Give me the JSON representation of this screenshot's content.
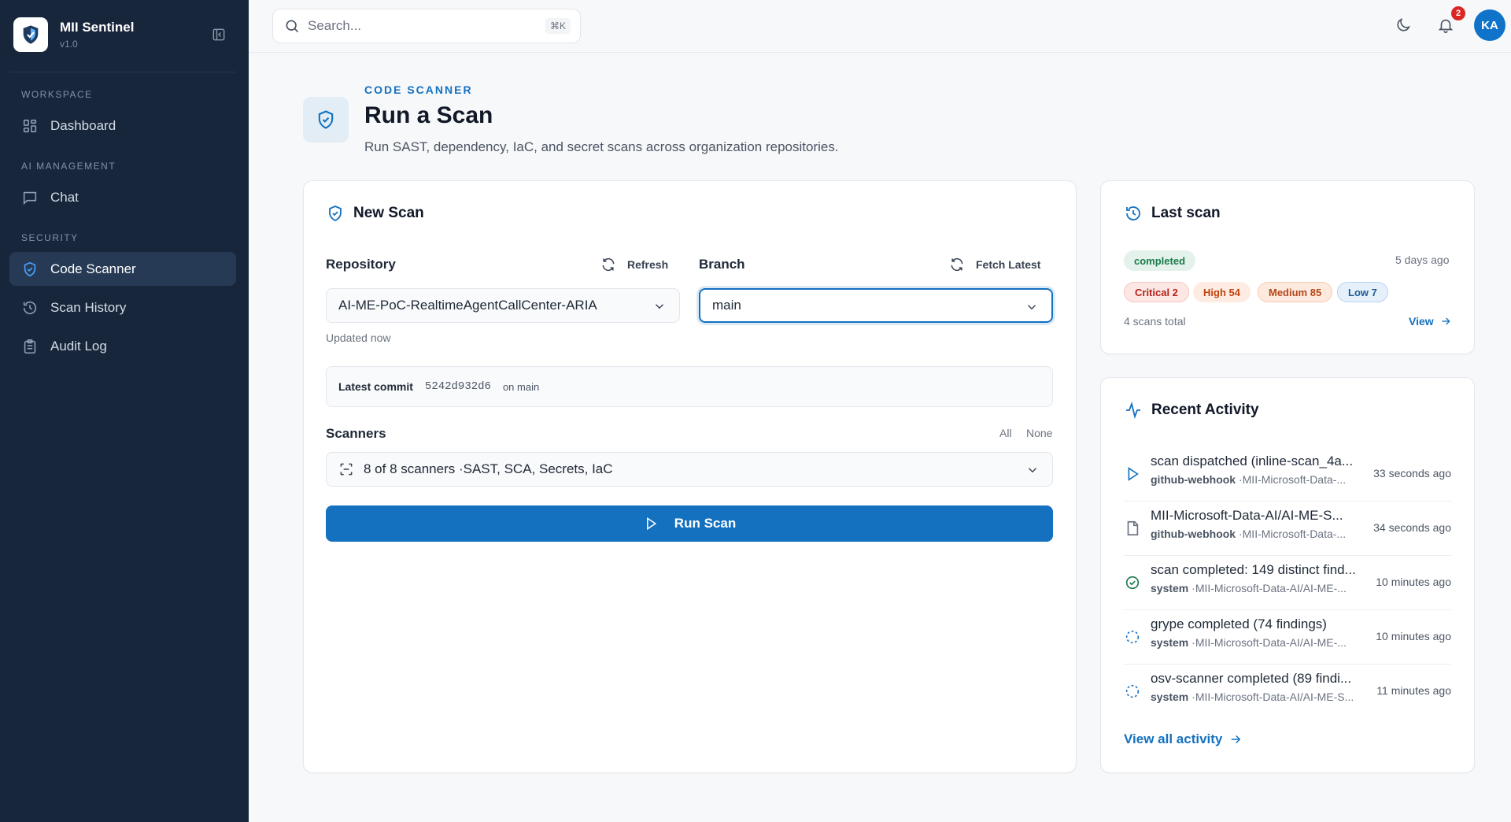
{
  "app": {
    "name": "MII Sentinel",
    "version": "v1.0"
  },
  "sidebar": {
    "sections": [
      {
        "label": "WORKSPACE",
        "items": [
          {
            "label": "Dashboard",
            "icon": "grid-icon"
          }
        ]
      },
      {
        "label": "AI MANAGEMENT",
        "items": [
          {
            "label": "Chat",
            "icon": "chat-icon"
          }
        ]
      },
      {
        "label": "SECURITY",
        "items": [
          {
            "label": "Code Scanner",
            "icon": "shield-check-icon",
            "active": true
          },
          {
            "label": "Scan History",
            "icon": "history-icon"
          },
          {
            "label": "Audit Log",
            "icon": "clipboard-icon"
          }
        ]
      }
    ]
  },
  "topbar": {
    "search_placeholder": "Search...",
    "search_shortcut": "⌘K",
    "notification_count": "2",
    "avatar_initials": "KA"
  },
  "page": {
    "eyebrow": "CODE SCANNER",
    "title": "Run a Scan",
    "subtitle": "Run SAST, dependency, IaC, and secret scans across organization repositories."
  },
  "new_scan": {
    "title": "New Scan",
    "repository_label": "Repository",
    "refresh_label": "Refresh",
    "repository_value": "AI-ME-PoC-RealtimeAgentCallCenter-ARIA",
    "updated_text": "Updated now",
    "branch_label": "Branch",
    "fetch_latest_label": "Fetch Latest",
    "branch_value": "main",
    "latest_commit_label": "Latest commit",
    "commit_hash": "5242d932d6",
    "commit_branch": "on main",
    "scanners_label": "Scanners",
    "all_label": "All",
    "none_label": "None",
    "scanners_value": "8 of 8 scanners ·SAST, SCA, Secrets, IaC",
    "run_label": "Run Scan"
  },
  "last_scan": {
    "title": "Last scan",
    "status": "completed",
    "when": "5 days ago",
    "severities": [
      {
        "label": "Critical 2",
        "level": "crit"
      },
      {
        "label": "High 54",
        "level": "high"
      },
      {
        "label": "Medium 85",
        "level": "med"
      },
      {
        "label": "Low 7",
        "level": "low"
      }
    ],
    "total": "4 scans total",
    "view_label": "View"
  },
  "recent_activity": {
    "title": "Recent Activity",
    "items": [
      {
        "title": "scan dispatched (inline-scan_4a...",
        "actor": "github-webhook",
        "detail": " ·MII-Microsoft-Data-...",
        "time": "33 seconds ago",
        "icon": "play-icon"
      },
      {
        "title": "MII-Microsoft-Data-AI/AI-ME-S...",
        "actor": "github-webhook",
        "detail": " ·MII-Microsoft-Data-...",
        "time": "34 seconds ago",
        "icon": "file-icon"
      },
      {
        "title": "scan completed: 149 distinct find...",
        "actor": "system",
        "detail": " ·MII-Microsoft-Data-AI/AI-ME-...",
        "time": "10 minutes ago",
        "icon": "check-circle-icon"
      },
      {
        "title": "grype completed (74 findings)",
        "actor": "system",
        "detail": " ·MII-Microsoft-Data-AI/AI-ME-...",
        "time": "10 minutes ago",
        "icon": "dashed-circle-icon"
      },
      {
        "title": "osv-scanner completed (89 findi...",
        "actor": "system",
        "detail": " ·MII-Microsoft-Data-AI/AI-ME-S...",
        "time": "11 minutes ago",
        "icon": "dashed-circle-icon"
      }
    ],
    "view_all_label": "View all activity"
  },
  "colors": {
    "accent": "#1371c0",
    "sidebar_bg": "#17263a",
    "sidebar_active": "#263a55"
  }
}
